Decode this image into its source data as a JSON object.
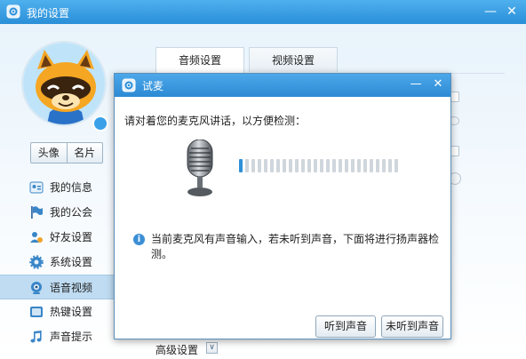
{
  "window": {
    "title": "我的设置",
    "minimize_glyph": "—",
    "close_glyph": "✕"
  },
  "avatar_tabs": [
    "头像",
    "名片"
  ],
  "sidebar": {
    "items": [
      {
        "label": "我的信息",
        "icon": "id-card-icon"
      },
      {
        "label": "我的公会",
        "icon": "flag-icon"
      },
      {
        "label": "好友设置",
        "icon": "friends-icon"
      },
      {
        "label": "系统设置",
        "icon": "gear-icon"
      },
      {
        "label": "语音视频",
        "icon": "webcam-icon",
        "active": true
      },
      {
        "label": "热键设置",
        "icon": "keyboard-icon"
      },
      {
        "label": "声音提示",
        "icon": "music-note-icon"
      }
    ]
  },
  "content_tabs": [
    {
      "label": "音频设置",
      "active": true
    },
    {
      "label": "视频设置",
      "active": false
    }
  ],
  "advanced": {
    "label": "高级设置",
    "toggle_glyph": "∨"
  },
  "dialog": {
    "title": "试麦",
    "minimize_glyph": "—",
    "close_glyph": "✕",
    "instruction": "请对着您的麦克风讲话，以方便检测：",
    "mic_level": {
      "segments": 26,
      "lit": 1
    },
    "info_icon_glyph": "i",
    "info_text": "当前麦克风有声音输入，若未听到声音，下面将进行扬声器检测。",
    "buttons": {
      "heard": "听到声音",
      "not_heard": "未听到声音"
    }
  },
  "colors": {
    "titlebar": "#2a8fd8",
    "accent": "#2f90d8",
    "active_nav": "#bfdcf2"
  }
}
